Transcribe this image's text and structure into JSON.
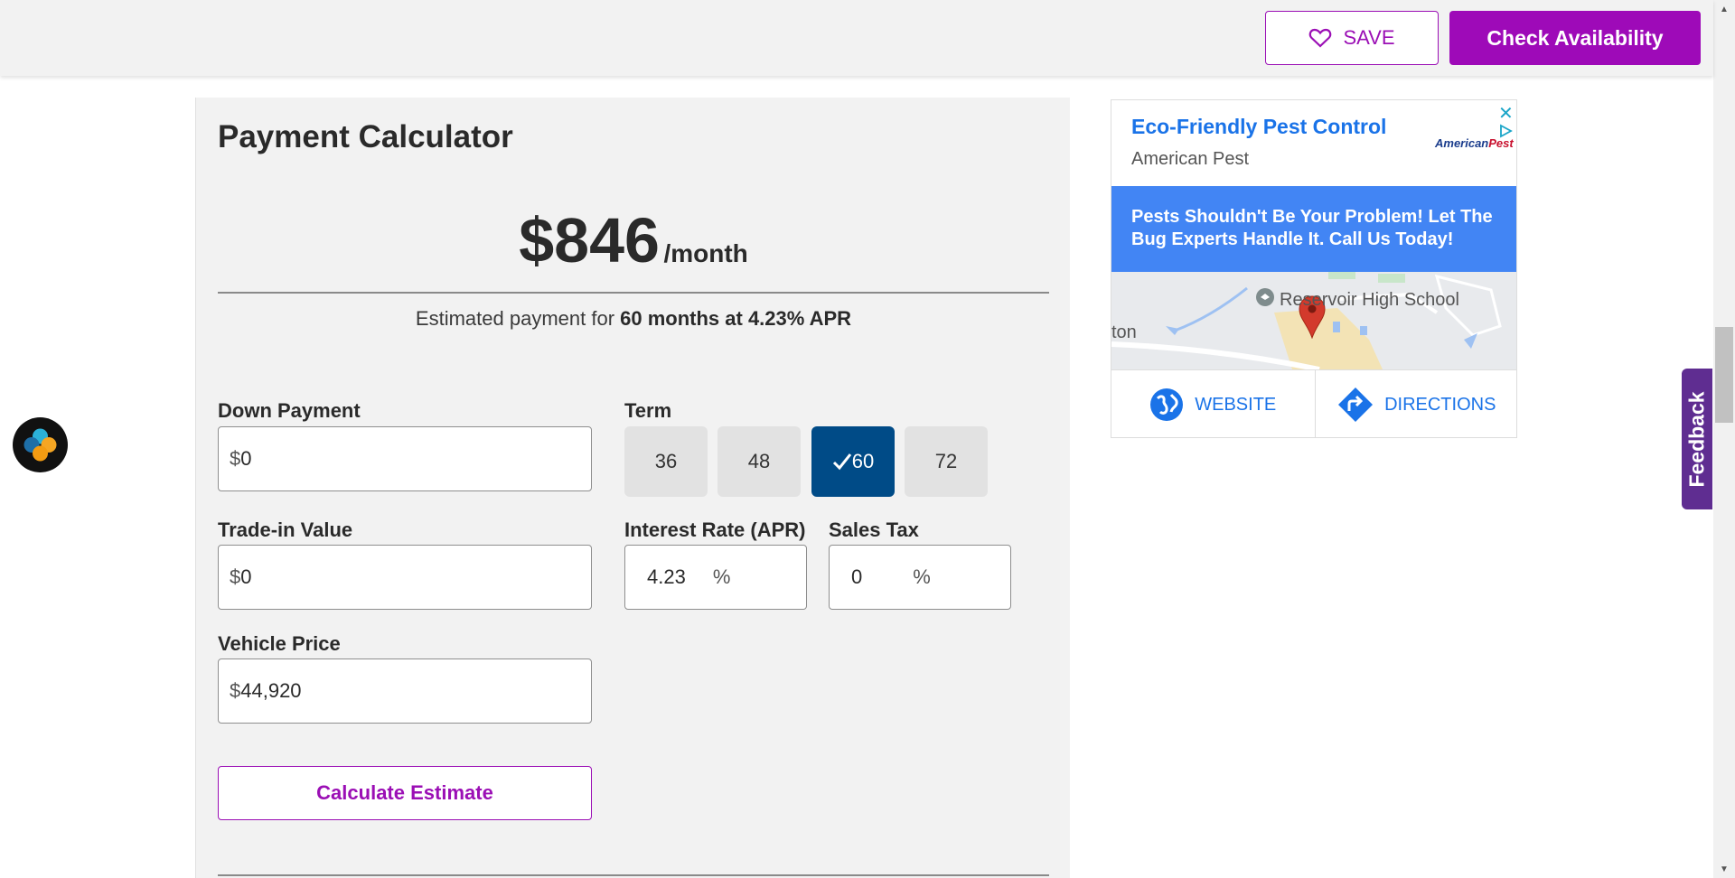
{
  "header": {
    "save_label": "SAVE",
    "availability_label": "Check Availability"
  },
  "calculator": {
    "title": "Payment Calculator",
    "monthly_amount": "$846",
    "monthly_unit": "/month",
    "estimate_prefix": "Estimated payment for ",
    "estimate_detail": "60 months at 4.23% APR",
    "down_payment": {
      "label": "Down Payment",
      "symbol": "$",
      "value": "0"
    },
    "trade_in": {
      "label": "Trade-in Value",
      "symbol": "$",
      "value": "0"
    },
    "vehicle_price": {
      "label": "Vehicle Price",
      "symbol": "$",
      "value": "44,920"
    },
    "term": {
      "label": "Term",
      "options": [
        "36",
        "48",
        "60",
        "72"
      ],
      "selected": "60"
    },
    "interest": {
      "label": "Interest Rate (APR)",
      "value": "4.23",
      "unit": "%"
    },
    "sales_tax": {
      "label": "Sales Tax",
      "value": "0",
      "unit": "%"
    },
    "calculate_label": "Calculate Estimate"
  },
  "ad": {
    "title": "Eco-Friendly Pest Control",
    "advertiser": "American Pest",
    "logo_text": "AmericanPest",
    "banner": "Pests Shouldn't Be Your Problem! Let The Bug Experts Handle It. Call Us Today!",
    "map_label": "Reservoir High School",
    "map_left_label": "ton",
    "website_label": "WEBSITE",
    "directions_label": "DIRECTIONS"
  },
  "feedback_label": "Feedback",
  "colors": {
    "brand_purple": "#9e0ab8",
    "term_active": "#004b87",
    "ad_blue": "#4285f4",
    "feedback": "#5f2d91"
  }
}
